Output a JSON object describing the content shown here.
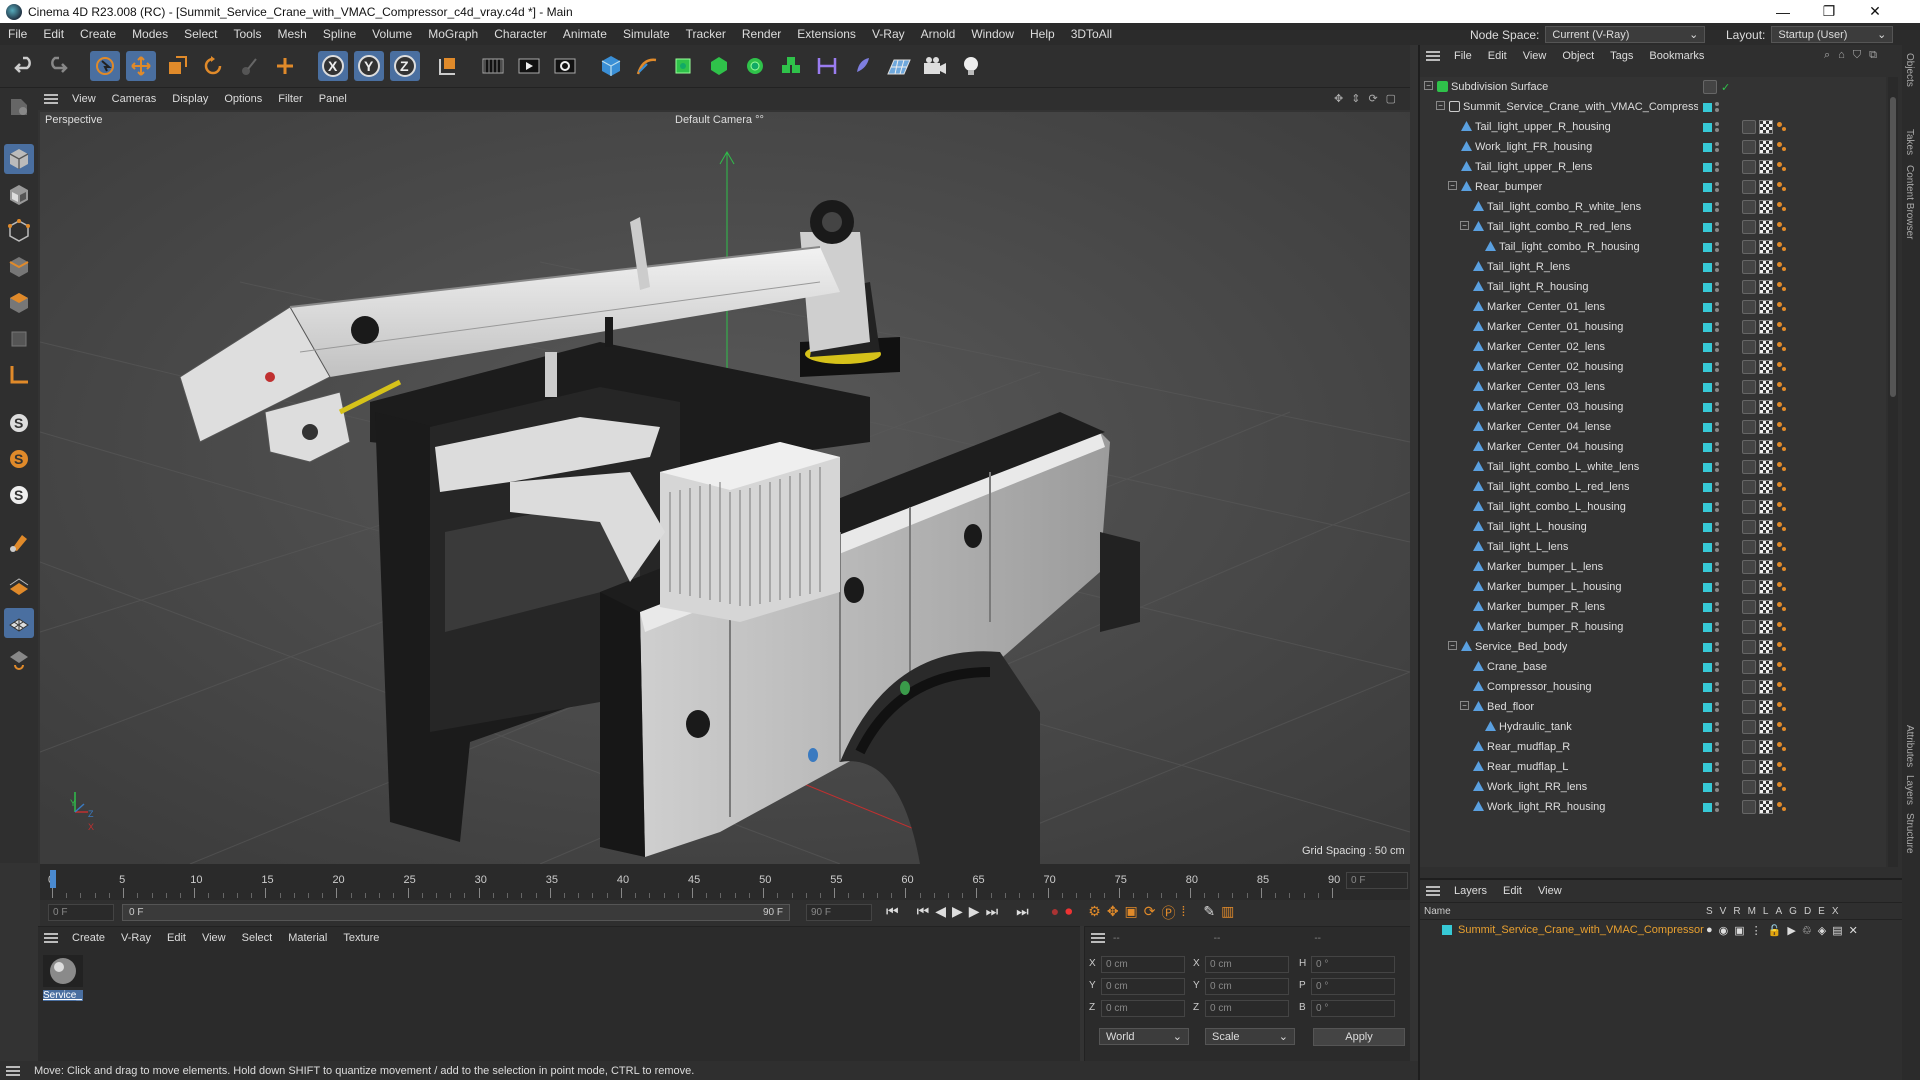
{
  "window": {
    "title": "Cinema 4D R23.008 (RC) - [Summit_Service_Crane_with_VMAC_Compressor_c4d_vray.c4d *] - Main",
    "minimize": "—",
    "maximize": "❐",
    "close": "✕"
  },
  "menubar": {
    "items": [
      "File",
      "Edit",
      "Create",
      "Modes",
      "Select",
      "Tools",
      "Mesh",
      "Spline",
      "Volume",
      "MoGraph",
      "Character",
      "Animate",
      "Simulate",
      "Tracker",
      "Render",
      "Extensions",
      "V-Ray",
      "Arnold",
      "Window",
      "Help",
      "3DToAll"
    ],
    "node_space_label": "Node Space:",
    "node_space_value": "Current (V-Ray)",
    "layout_label": "Layout:",
    "layout_value": "Startup (User)"
  },
  "viewport": {
    "menu": [
      "View",
      "Cameras",
      "Display",
      "Options",
      "Filter",
      "Panel"
    ],
    "view_name": "Perspective",
    "camera_label": "Default Camera",
    "camera_icon": "°°",
    "grid_spacing": "Grid Spacing : 50 cm",
    "axis_y": "Y",
    "axis_z": "Z",
    "axis_x": "X"
  },
  "timeline": {
    "ticks": [
      "0",
      "5",
      "10",
      "15",
      "20",
      "25",
      "30",
      "35",
      "40",
      "45",
      "50",
      "55",
      "60",
      "65",
      "70",
      "75",
      "80",
      "85",
      "90"
    ],
    "current_frame": "0 F",
    "start_field": "0 F",
    "range_start": "0 F",
    "range_end": "90 F",
    "end_field": "90 F"
  },
  "material_panel": {
    "menu": [
      "Create",
      "V-Ray",
      "Edit",
      "View",
      "Select",
      "Material",
      "Texture"
    ],
    "material_name": "Service_"
  },
  "coord_panel": {
    "header": [
      "--",
      "--",
      "--"
    ],
    "rows": [
      {
        "a": "X",
        "av": "0 cm",
        "b": "X",
        "bv": "0 cm",
        "c": "H",
        "cv": "0 °"
      },
      {
        "a": "Y",
        "av": "0 cm",
        "b": "Y",
        "bv": "0 cm",
        "c": "P",
        "cv": "0 °"
      },
      {
        "a": "Z",
        "av": "0 cm",
        "b": "Z",
        "bv": "0 cm",
        "c": "B",
        "cv": "0 °"
      }
    ],
    "world": "World",
    "scale": "Scale",
    "apply": "Apply"
  },
  "status": "Move: Click and drag to move elements. Hold down SHIFT to quantize movement / add to the selection in point mode, CTRL to remove.",
  "objects_panel": {
    "menu": [
      "File",
      "Edit",
      "View",
      "Object",
      "Tags",
      "Bookmarks"
    ],
    "rows": [
      {
        "name": "Subdivision Surface",
        "depth": 0,
        "expand": "-",
        "type": "subd"
      },
      {
        "name": "Summit_Service_Crane_with_VMAC_Compressor",
        "depth": 1,
        "expand": "-",
        "type": "null"
      },
      {
        "name": "Tail_light_upper_R_housing",
        "depth": 2,
        "expand": "",
        "type": "poly"
      },
      {
        "name": "Work_light_FR_housing",
        "depth": 2,
        "expand": "",
        "type": "poly"
      },
      {
        "name": "Tail_light_upper_R_lens",
        "depth": 2,
        "expand": "",
        "type": "poly"
      },
      {
        "name": "Rear_bumper",
        "depth": 2,
        "expand": "-",
        "type": "poly"
      },
      {
        "name": "Tail_light_combo_R_white_lens",
        "depth": 3,
        "expand": "",
        "type": "poly"
      },
      {
        "name": "Tail_light_combo_R_red_lens",
        "depth": 3,
        "expand": "-",
        "type": "poly"
      },
      {
        "name": "Tail_light_combo_R_housing",
        "depth": 4,
        "expand": "",
        "type": "poly"
      },
      {
        "name": "Tail_light_R_lens",
        "depth": 3,
        "expand": "",
        "type": "poly"
      },
      {
        "name": "Tail_light_R_housing",
        "depth": 3,
        "expand": "",
        "type": "poly"
      },
      {
        "name": "Marker_Center_01_lens",
        "depth": 3,
        "expand": "",
        "type": "poly"
      },
      {
        "name": "Marker_Center_01_housing",
        "depth": 3,
        "expand": "",
        "type": "poly"
      },
      {
        "name": "Marker_Center_02_lens",
        "depth": 3,
        "expand": "",
        "type": "poly"
      },
      {
        "name": "Marker_Center_02_housing",
        "depth": 3,
        "expand": "",
        "type": "poly"
      },
      {
        "name": "Marker_Center_03_lens",
        "depth": 3,
        "expand": "",
        "type": "poly"
      },
      {
        "name": "Marker_Center_03_housing",
        "depth": 3,
        "expand": "",
        "type": "poly"
      },
      {
        "name": "Marker_Center_04_lense",
        "depth": 3,
        "expand": "",
        "type": "poly"
      },
      {
        "name": "Marker_Center_04_housing",
        "depth": 3,
        "expand": "",
        "type": "poly"
      },
      {
        "name": "Tail_light_combo_L_white_lens",
        "depth": 3,
        "expand": "",
        "type": "poly"
      },
      {
        "name": "Tail_light_combo_L_red_lens",
        "depth": 3,
        "expand": "",
        "type": "poly"
      },
      {
        "name": "Tail_light_combo_L_housing",
        "depth": 3,
        "expand": "",
        "type": "poly"
      },
      {
        "name": "Tail_light_L_housing",
        "depth": 3,
        "expand": "",
        "type": "poly"
      },
      {
        "name": "Tail_light_L_lens",
        "depth": 3,
        "expand": "",
        "type": "poly"
      },
      {
        "name": "Marker_bumper_L_lens",
        "depth": 3,
        "expand": "",
        "type": "poly"
      },
      {
        "name": "Marker_bumper_L_housing",
        "depth": 3,
        "expand": "",
        "type": "poly"
      },
      {
        "name": "Marker_bumper_R_lens",
        "depth": 3,
        "expand": "",
        "type": "poly"
      },
      {
        "name": "Marker_bumper_R_housing",
        "depth": 3,
        "expand": "",
        "type": "poly"
      },
      {
        "name": "Service_Bed_body",
        "depth": 2,
        "expand": "-",
        "type": "poly"
      },
      {
        "name": "Crane_base",
        "depth": 3,
        "expand": "",
        "type": "poly"
      },
      {
        "name": "Compressor_housing",
        "depth": 3,
        "expand": "",
        "type": "poly"
      },
      {
        "name": "Bed_floor",
        "depth": 3,
        "expand": "-",
        "type": "poly"
      },
      {
        "name": "Hydraulic_tank",
        "depth": 4,
        "expand": "",
        "type": "poly"
      },
      {
        "name": "Rear_mudflap_R",
        "depth": 3,
        "expand": "",
        "type": "poly"
      },
      {
        "name": "Rear_mudflap_L",
        "depth": 3,
        "expand": "",
        "type": "poly"
      },
      {
        "name": "Work_light_RR_lens",
        "depth": 3,
        "expand": "",
        "type": "poly"
      },
      {
        "name": "Work_light_RR_housing",
        "depth": 3,
        "expand": "",
        "type": "poly"
      }
    ]
  },
  "layers_panel": {
    "menu": [
      "Layers",
      "Edit",
      "View"
    ],
    "col_name": "Name",
    "col_flags": [
      "S",
      "V",
      "R",
      "M",
      "L",
      "A",
      "G",
      "D",
      "E",
      "X"
    ],
    "layer_name": "Summit_Service_Crane_with_VMAC_Compressor",
    "layer_color": "#37c9d6"
  },
  "side_tabs": [
    "Objects",
    "Takes",
    "Content Browser",
    "Attributes",
    "Layers",
    "Structure"
  ],
  "colors": {
    "accent_orange": "#e08a2a",
    "layer_name": "#e8a030",
    "cyan": "#37c9d6"
  }
}
